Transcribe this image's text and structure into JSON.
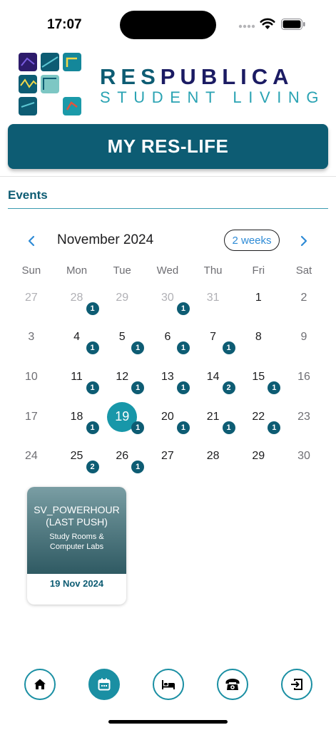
{
  "status_bar": {
    "time": "17:07"
  },
  "brand": {
    "name_part1": "RES",
    "name_part2": "PUBLICA",
    "subtitle": "STUDENT LIVING",
    "colors": {
      "primary": "#0d5c73",
      "accent": "#1b1b63",
      "light": "#2aa3b3"
    }
  },
  "banner": {
    "title": "MY RES-LIFE"
  },
  "section": {
    "title": "Events"
  },
  "calendar": {
    "month_label": "November 2024",
    "format_button": "2 weeks",
    "prev_icon": "chevron-left-icon",
    "next_icon": "chevron-right-icon",
    "weekdays": [
      "Sun",
      "Mon",
      "Tue",
      "Wed",
      "Thu",
      "Fri",
      "Sat"
    ],
    "selected_day": "19",
    "selected_color": "#1897a9",
    "badge_color": "#0d5c73",
    "days": [
      {
        "day": "27",
        "count": "",
        "outside": true
      },
      {
        "day": "28",
        "count": "1",
        "outside": true
      },
      {
        "day": "29",
        "count": "",
        "outside": true
      },
      {
        "day": "30",
        "count": "1",
        "outside": true
      },
      {
        "day": "31",
        "count": "",
        "outside": true
      },
      {
        "day": "1",
        "count": ""
      },
      {
        "day": "2",
        "count": ""
      },
      {
        "day": "3",
        "count": ""
      },
      {
        "day": "4",
        "count": "1"
      },
      {
        "day": "5",
        "count": "1"
      },
      {
        "day": "6",
        "count": "1"
      },
      {
        "day": "7",
        "count": "1"
      },
      {
        "day": "8",
        "count": ""
      },
      {
        "day": "9",
        "count": ""
      },
      {
        "day": "10",
        "count": ""
      },
      {
        "day": "11",
        "count": "1"
      },
      {
        "day": "12",
        "count": "1"
      },
      {
        "day": "13",
        "count": "1"
      },
      {
        "day": "14",
        "count": "2"
      },
      {
        "day": "15",
        "count": "1"
      },
      {
        "day": "16",
        "count": ""
      },
      {
        "day": "17",
        "count": ""
      },
      {
        "day": "18",
        "count": "1"
      },
      {
        "day": "19",
        "count": "1",
        "selected": true
      },
      {
        "day": "20",
        "count": "1"
      },
      {
        "day": "21",
        "count": "1"
      },
      {
        "day": "22",
        "count": "1"
      },
      {
        "day": "23",
        "count": ""
      },
      {
        "day": "24",
        "count": ""
      },
      {
        "day": "25",
        "count": "2"
      },
      {
        "day": "26",
        "count": "1"
      },
      {
        "day": "27",
        "count": ""
      },
      {
        "day": "28",
        "count": ""
      },
      {
        "day": "29",
        "count": ""
      },
      {
        "day": "30",
        "count": ""
      }
    ]
  },
  "events": [
    {
      "title": "SV_POWERHOUR (LAST PUSH)",
      "location": "Study Rooms & Computer Labs",
      "date": "19 Nov 2024"
    }
  ],
  "bottom_nav": {
    "active_color": "#1a8fa3",
    "items": [
      {
        "icon": "home-icon"
      },
      {
        "icon": "calendar-icon",
        "active": true
      },
      {
        "icon": "bed-icon"
      },
      {
        "icon": "phone-icon"
      },
      {
        "icon": "logout-icon"
      }
    ]
  }
}
